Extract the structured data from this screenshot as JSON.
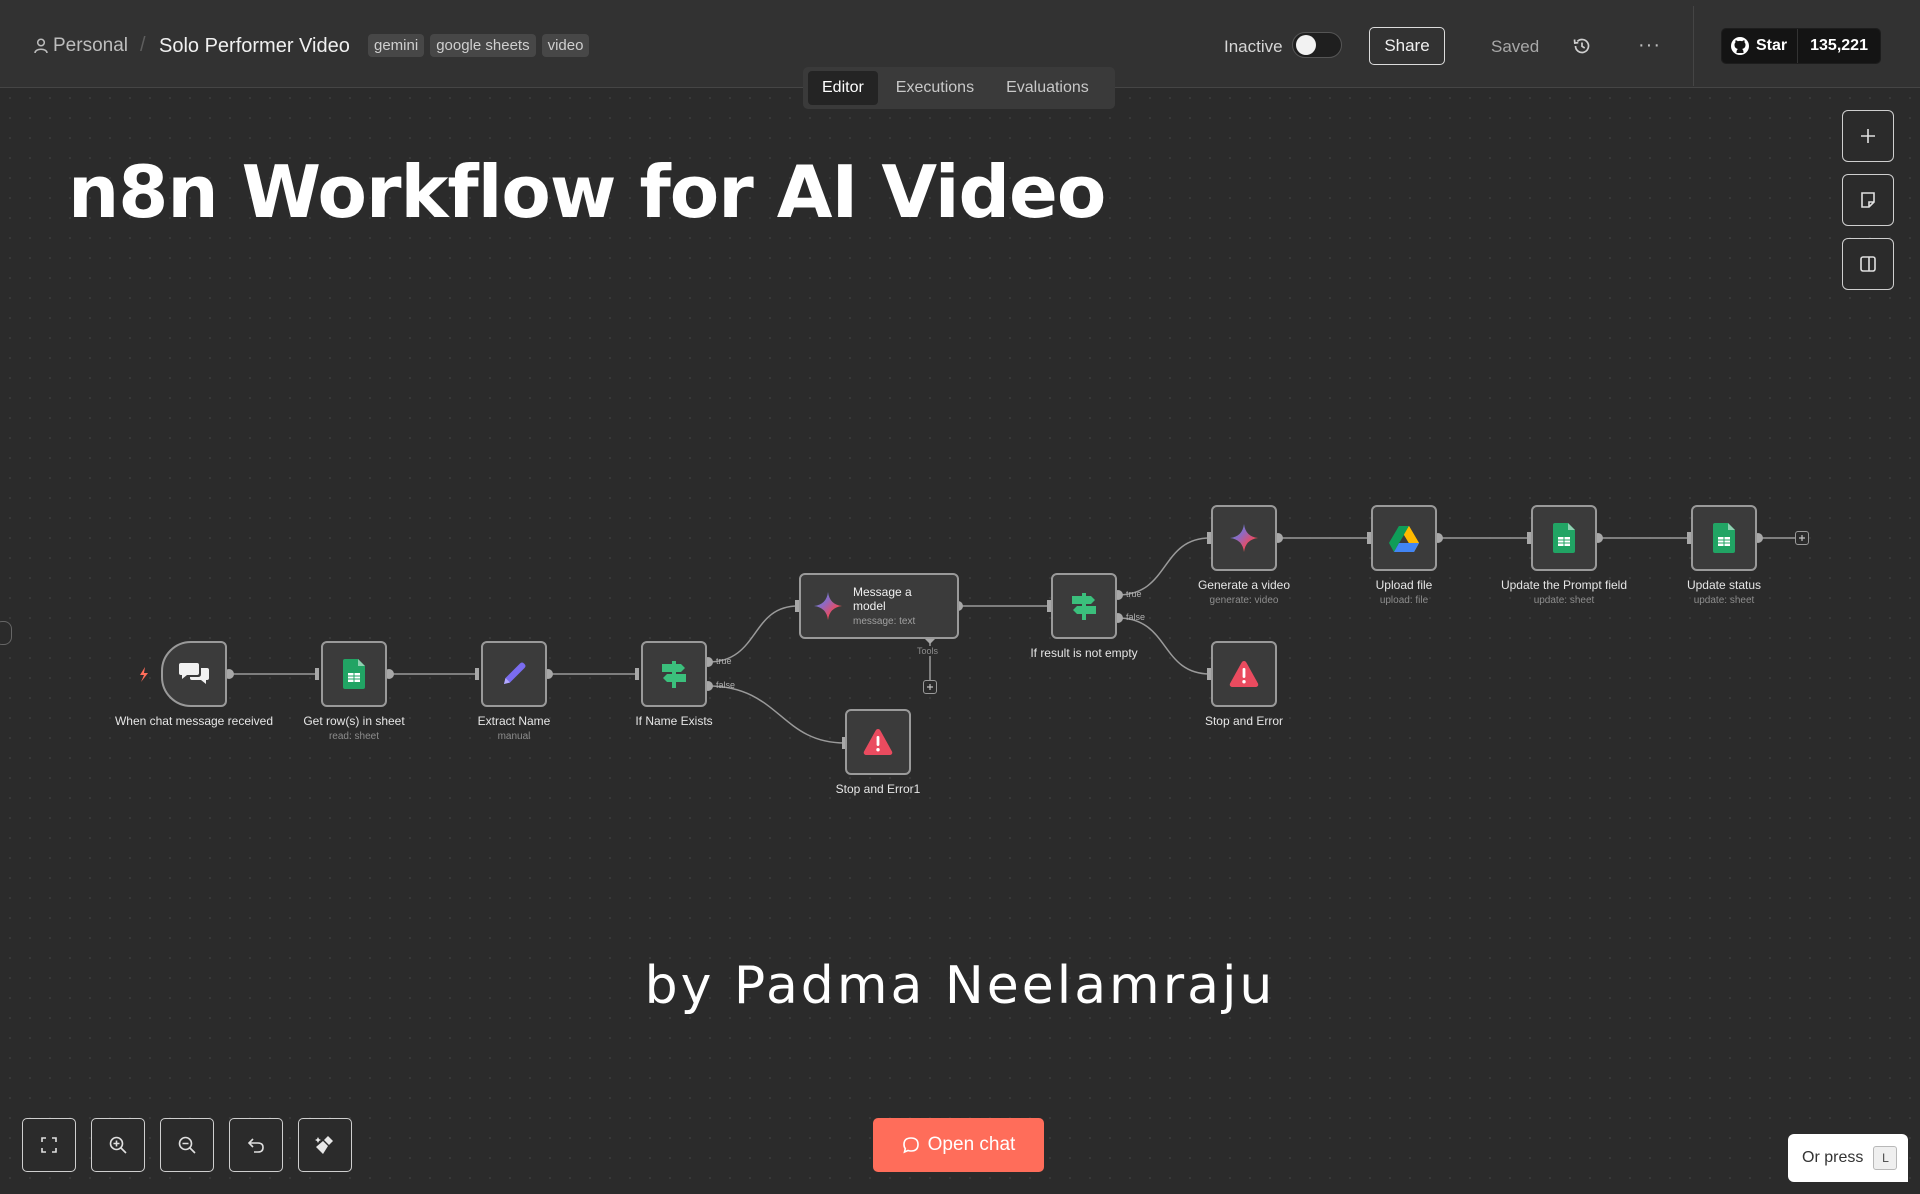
{
  "header": {
    "project": "Personal",
    "separator": "/",
    "workflow_title": "Solo Performer Video",
    "tags": [
      "gemini",
      "google sheets",
      "video"
    ],
    "status_label": "Inactive",
    "share_label": "Share",
    "saved_label": "Saved",
    "more_label": "···",
    "github": {
      "star_label": "Star",
      "star_count": "135,221"
    }
  },
  "tabs": [
    {
      "label": "Editor",
      "active": true
    },
    {
      "label": "Executions",
      "active": false
    },
    {
      "label": "Evaluations",
      "active": false
    }
  ],
  "canvas": {
    "title": "n8n Workflow for AI Video",
    "byline": "by Padma Neelamraju"
  },
  "nodes": {
    "chat_trigger": {
      "name": "When chat message received",
      "icon": "chat-bubbles-icon"
    },
    "get_rows": {
      "name": "Get row(s) in sheet",
      "sub": "read: sheet",
      "icon": "google-sheets-icon"
    },
    "extract_name": {
      "name": "Extract Name",
      "sub": "manual",
      "icon": "pencil-icon"
    },
    "if_name": {
      "name": "If Name Exists",
      "icon": "signpost-icon",
      "true_label": "true",
      "false_label": "false"
    },
    "message_model": {
      "name_line1": "Message a",
      "name_line2": "model",
      "sub": "message: text",
      "icon": "gemini-icon",
      "tools_label": "Tools"
    },
    "stop_error1": {
      "name": "Stop and Error1",
      "icon": "warning-icon"
    },
    "if_result": {
      "name": "If result is not empty",
      "icon": "signpost-icon",
      "true_label": "true",
      "false_label": "false"
    },
    "generate_video": {
      "name": "Generate a video",
      "sub": "generate: video",
      "icon": "gemini-icon"
    },
    "upload_file": {
      "name": "Upload file",
      "sub": "upload: file",
      "icon": "google-drive-icon"
    },
    "update_prompt": {
      "name": "Update the Prompt field",
      "sub": "update: sheet",
      "icon": "google-sheets-icon"
    },
    "update_status": {
      "name": "Update status",
      "sub": "update: sheet",
      "icon": "google-sheets-icon"
    },
    "stop_error": {
      "name": "Stop and Error",
      "icon": "warning-icon"
    }
  },
  "bottom": {
    "open_chat_label": "Open chat",
    "or_press_label": "Or press",
    "shortcut_key": "L"
  },
  "colors": {
    "background": "#2b2b2b",
    "accent": "#ff6d5a",
    "sheets_green": "#21a464",
    "error_red": "#ea4b5f",
    "pencil_purple": "#7a6cf0"
  }
}
